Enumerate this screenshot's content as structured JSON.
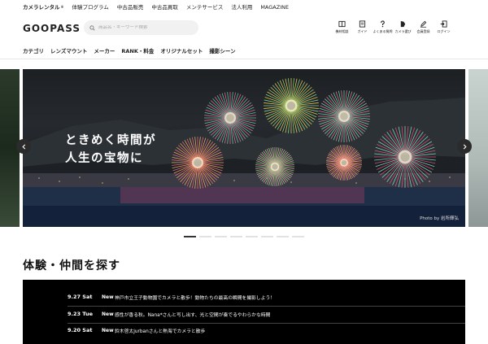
{
  "top_nav": {
    "items": [
      "カメラレンタル",
      "体験プログラム",
      "中古品販売",
      "中古品買取",
      "メンテサービス",
      "法人利用",
      "MAGAZINE"
    ],
    "superscript": "®"
  },
  "header": {
    "logo": "GOOPASS",
    "search_placeholder": "商品名・キーワード検索",
    "icons": [
      {
        "name": "book-icon",
        "label": "機材相談"
      },
      {
        "name": "guide-icon",
        "label": "ガイド"
      },
      {
        "name": "question-icon",
        "label": "よくある質問"
      },
      {
        "name": "camera-select-icon",
        "label": "カメラ選び"
      },
      {
        "name": "pen-icon",
        "label": "会員登録"
      },
      {
        "name": "login-icon",
        "label": "ログイン"
      }
    ]
  },
  "category_nav": [
    "カテゴリ",
    "レンズマウント",
    "メーカー",
    "RANK・料金",
    "オリジナルセット",
    "撮影シーン"
  ],
  "hero": {
    "line1": "ときめく時間が",
    "line2": "人生の宝物に",
    "photo_credit": "Photo by 岩所輝弘",
    "slide_count": 8,
    "active_slide": 0
  },
  "section": {
    "title": "体験・仲間を探す",
    "events": [
      {
        "date": "9.27 Sat",
        "badge": "New",
        "title": "神戸市立王子動物園でカメラと散歩！動物たちの最高の瞬間を撮影しよう！"
      },
      {
        "date": "9.23 Tue",
        "badge": "New",
        "title": "感性が香る秋。Nana*さんと写し出す、光と空間が奏でるやわらかな時間"
      },
      {
        "date": "9.20 Sat",
        "badge": "New",
        "title": "鈴木啓太jurbanさんと熱海でカメラと散歩"
      }
    ]
  },
  "colors": {
    "event_bg": "#000000",
    "text": "#111111",
    "search_bg": "#f1f1f1"
  }
}
